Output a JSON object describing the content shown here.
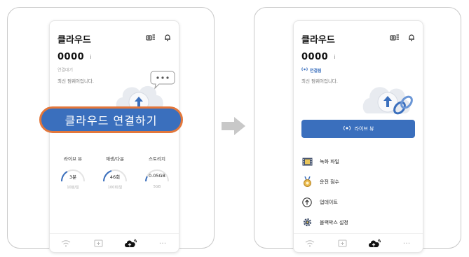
{
  "left_screen": {
    "app_title": "클라우드",
    "device_id": "0000",
    "info_icon": "i",
    "status": "연결대기",
    "subtitle": "최신 펌웨어입니다.",
    "connect_button": "클라우드 연결하기",
    "stats": [
      {
        "label": "라이브 뷰",
        "value": "3분",
        "caption": "10분/일"
      },
      {
        "label": "재생/다운",
        "value": "46회",
        "caption": "100회/일"
      },
      {
        "label": "스토리지",
        "value": "0.05GB",
        "caption": "5GB"
      }
    ]
  },
  "right_screen": {
    "app_title": "클라우드",
    "device_id": "0000",
    "info_icon": "i",
    "status": "연결됨",
    "subtitle": "최신 펌웨어입니다.",
    "live_button": "라이브 뷰",
    "menu": [
      {
        "label": "녹화 파일",
        "icon": "film-icon"
      },
      {
        "label": "운전 점수",
        "icon": "medal-icon"
      },
      {
        "label": "업데이트",
        "icon": "upload-circle-icon"
      },
      {
        "label": "블랙박스 설정",
        "icon": "gear-icon"
      }
    ]
  },
  "tabbar": [
    "wifi-icon",
    "folder-icon",
    "cloud-icon",
    "more-icon"
  ],
  "colors": {
    "primary": "#3a6fbd",
    "highlight": "#e3773b",
    "arrow": "#c8c8c8"
  }
}
